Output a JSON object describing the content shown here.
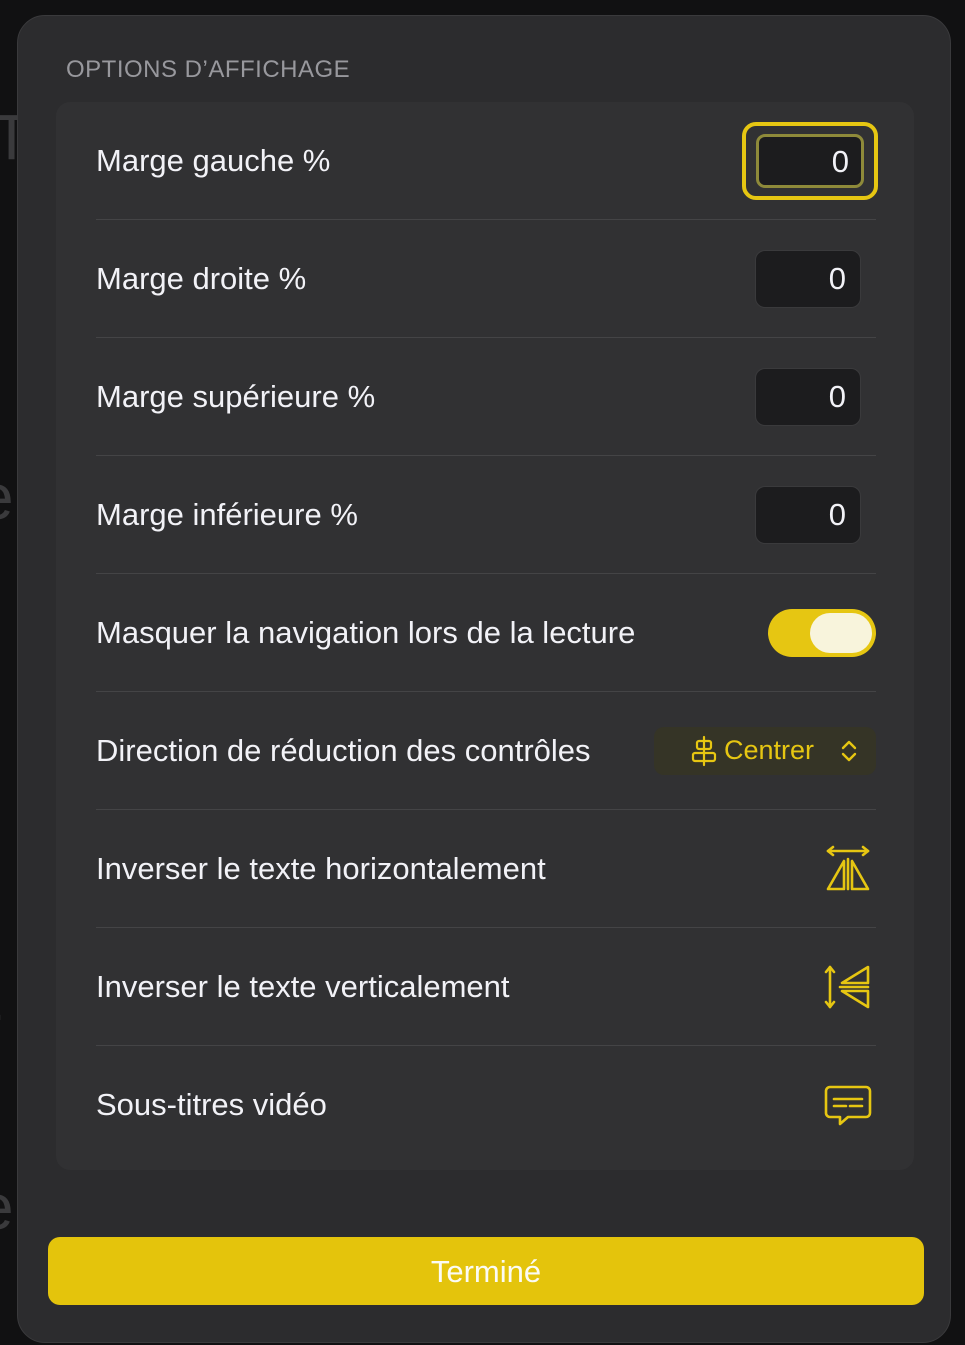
{
  "section": {
    "title": "OPTIONS D’AFFICHAGE"
  },
  "rows": {
    "left_margin": {
      "label": "Marge gauche %",
      "value": "0"
    },
    "right_margin": {
      "label": "Marge droite %",
      "value": "0"
    },
    "top_margin": {
      "label": "Marge supérieure %",
      "value": "0"
    },
    "bottom_margin": {
      "label": "Marge inférieure %",
      "value": "0"
    },
    "hide_nav": {
      "label": "Masquer la navigation lors de la lecture",
      "toggle_on": true
    },
    "collapse_direction": {
      "label": "Direction de réduction des contrôles",
      "selected": "Centrer",
      "icon": "align-center-icon"
    },
    "flip_horizontal": {
      "label": "Inverser le texte horizontalement",
      "icon": "flip-horizontal-icon"
    },
    "flip_vertical": {
      "label": "Inverser le texte verticalement",
      "icon": "flip-vertical-icon"
    },
    "subtitles": {
      "label": "Sous-titres vidéo",
      "icon": "subtitles-icon"
    }
  },
  "footer": {
    "done_label": "Terminé"
  },
  "colors": {
    "accent": "#e6c612",
    "panel_bg": "#2c2c2e",
    "group_bg": "#313133",
    "text": "#f2f2f7",
    "muted": "#98989d"
  }
}
